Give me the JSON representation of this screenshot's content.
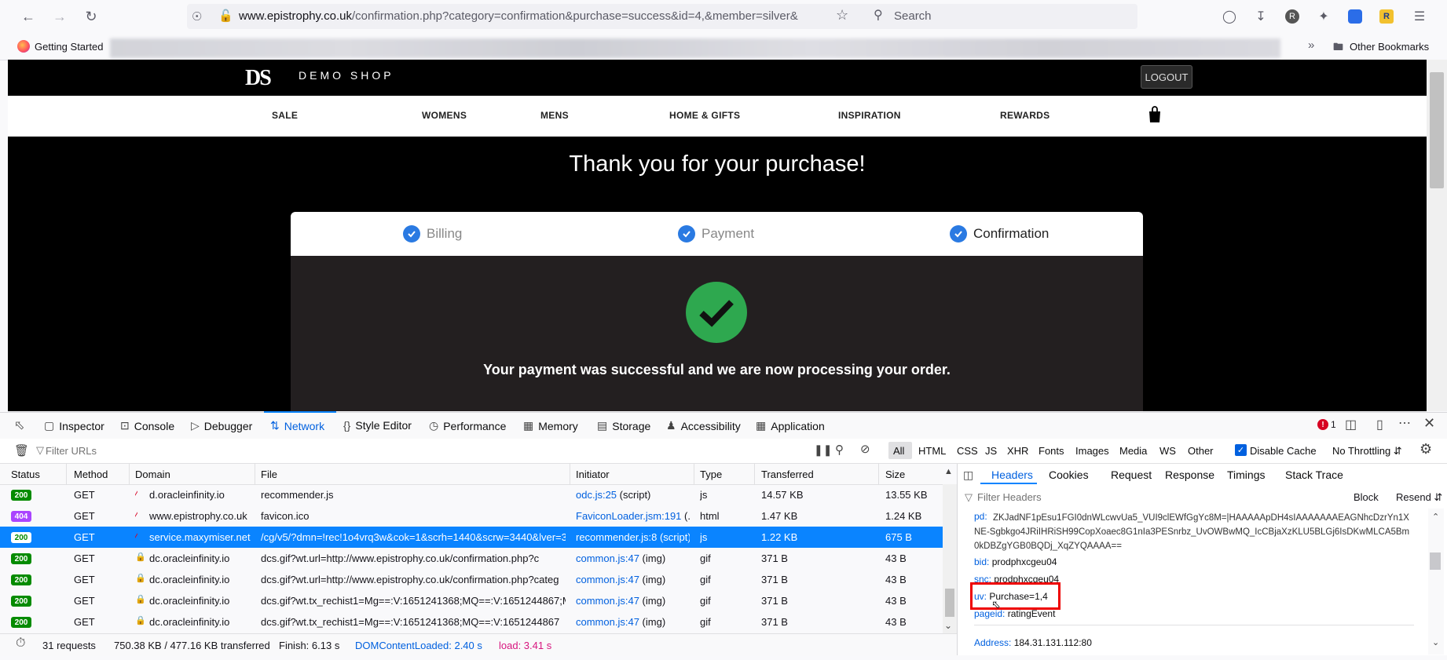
{
  "browser": {
    "url_domain": "www.epistrophy.co.uk",
    "url_rest": "/confirmation.php?category=confirmation&purchase=success&id=4,&member=silver&",
    "search_placeholder": "Search",
    "bookmark_getting_started": "Getting Started",
    "bookmark_other": "Other Bookmarks"
  },
  "shop": {
    "logo": "DS",
    "name": "DEMO SHOP",
    "logout": "LOGOUT",
    "menu": [
      "SALE",
      "WOMENS",
      "MENS",
      "HOME & GIFTS",
      "INSPIRATION",
      "REWARDS"
    ],
    "thank_you": "Thank you for your purchase!",
    "steps": [
      "Billing",
      "Payment",
      "Confirmation"
    ],
    "success_message": "Your payment was successful and we are now processing your order."
  },
  "devtools": {
    "tabs": [
      "Inspector",
      "Console",
      "Debugger",
      "Network",
      "Style Editor",
      "Performance",
      "Memory",
      "Storage",
      "Accessibility",
      "Application"
    ],
    "error_count": "1",
    "filter_placeholder": "Filter URLs",
    "type_filters": [
      "All",
      "HTML",
      "CSS",
      "JS",
      "XHR",
      "Fonts",
      "Images",
      "Media",
      "WS",
      "Other"
    ],
    "disable_cache": "Disable Cache",
    "throttling": "No Throttling",
    "columns": [
      "Status",
      "Method",
      "Domain",
      "File",
      "Initiator",
      "Type",
      "Transferred",
      "Size"
    ],
    "rows": [
      {
        "status": "200",
        "method": "GET",
        "domain": "d.oracleinfinity.io",
        "file": "recommender.js",
        "initiator": "odc.js:25",
        "initiator_type": "(script)",
        "type": "js",
        "transferred": "14.57 KB",
        "size": "13.55 KB"
      },
      {
        "status": "404",
        "method": "GET",
        "domain": "www.epistrophy.co.uk",
        "file": "favicon.ico",
        "initiator": "FaviconLoader.jsm:191",
        "initiator_type": "(...",
        "type": "html",
        "transferred": "1.47 KB",
        "size": "1.24 KB"
      },
      {
        "status": "200",
        "method": "GET",
        "domain": "service.maxymiser.net",
        "file": "/cg/v5/?dmn=!rec!1o4vrq3w&cok=1&scrh=1440&scrw=3440&lver=3",
        "initiator": "recommender.js:8",
        "initiator_type": "(script)",
        "type": "js",
        "transferred": "1.22 KB",
        "size": "675 B"
      },
      {
        "status": "200",
        "method": "GET",
        "domain": "dc.oracleinfinity.io",
        "file": "dcs.gif?wt.url=http://www.epistrophy.co.uk/confirmation.php?c",
        "initiator": "common.js:47",
        "initiator_type": "(img)",
        "type": "gif",
        "transferred": "371 B",
        "size": "43 B"
      },
      {
        "status": "200",
        "method": "GET",
        "domain": "dc.oracleinfinity.io",
        "file": "dcs.gif?wt.url=http://www.epistrophy.co.uk/confirmation.php?categ",
        "initiator": "common.js:47",
        "initiator_type": "(img)",
        "type": "gif",
        "transferred": "371 B",
        "size": "43 B"
      },
      {
        "status": "200",
        "method": "GET",
        "domain": "dc.oracleinfinity.io",
        "file": "dcs.gif?wt.tx_rechist1=Mg==:V:1651241368;MQ==:V:1651244867;MC",
        "initiator": "common.js:47",
        "initiator_type": "(img)",
        "type": "gif",
        "transferred": "371 B",
        "size": "43 B"
      },
      {
        "status": "200",
        "method": "GET",
        "domain": "dc.oracleinfinity.io",
        "file": "dcs.gif?wt.tx_rechist1=Mg==:V:1651241368;MQ==:V:1651244867",
        "initiator": "common.js:47",
        "initiator_type": "(img)",
        "type": "gif",
        "transferred": "371 B",
        "size": "43 B"
      }
    ],
    "status_bar": {
      "requests": "31 requests",
      "transferred": "750.38 KB / 477.16 KB transferred",
      "finish": "Finish: 6.13 s",
      "dcl": "DOMContentLoaded: 2.40 s",
      "load": "load: 3.41 s"
    },
    "side_tabs": [
      "Headers",
      "Cookies",
      "Request",
      "Response",
      "Timings",
      "Stack Trace"
    ],
    "filter_headers": "Filter Headers",
    "block": "Block",
    "resend": "Resend",
    "params": {
      "pd_key": "pd:",
      "pd_val": "ZKJadNF1pEsu1FGI0dnWLcwvUa5_VUI9clEWfGgYc8M=|HAAAAApDH4sIAAAAAAAEAGNhcDzrYn1XNE-Sgbkgo4JRiIHRiSH99CopXoaec8G1nIa3PESnrbz_UvOWBwMQ_IcCBjaXzKLU5BLGj6IsDKwMLCA5Bm0kDBZgYGB0BQDj_XqZYQAAAA==",
      "bid_key": "bid:",
      "bid_val": "prodphxcgeu04",
      "snc_key": "snc:",
      "snc_val": "prodphxcgeu04",
      "uv_key": "uv:",
      "uv_val": "Purchase=1,4",
      "pageid_key": "pageid:",
      "pageid_val": "ratingEvent",
      "address_key": "Address:",
      "address_val": "184.31.131.112:80"
    }
  }
}
